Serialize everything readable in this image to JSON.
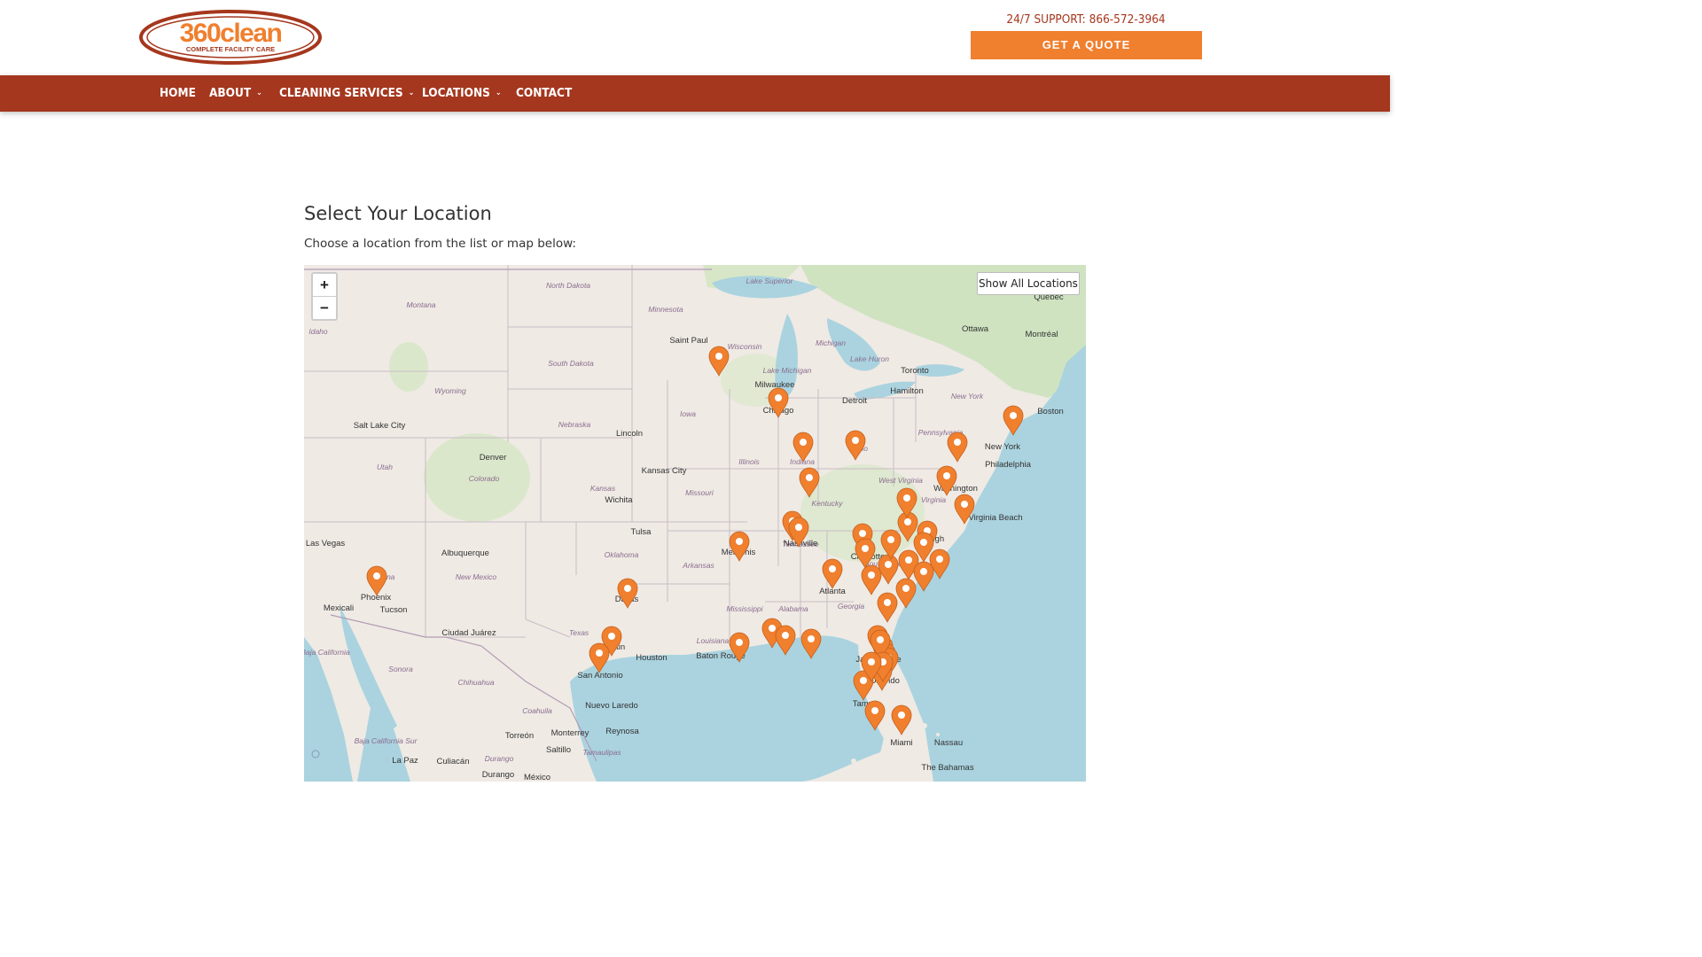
{
  "header": {
    "logo_text": "360clean",
    "logo_tagline": "COMPLETE FACILITY CARE",
    "support_text": "24/7 SUPPORT: 866-572-3964",
    "quote_button": "GET A QUOTE"
  },
  "nav": {
    "items": [
      {
        "label": "HOME"
      },
      {
        "label": "ABOUT"
      },
      {
        "label": "CLEANING SERVICES"
      },
      {
        "label": "LOCATIONS"
      },
      {
        "label": "CONTACT"
      }
    ]
  },
  "main": {
    "title": "Select Your Location",
    "subtitle": "Choose a location from the list or map below:"
  },
  "map": {
    "zoom_in": "+",
    "zoom_out": "−",
    "show_all_button": "Show All Locations",
    "place_labels": [
      "Saint Paul",
      "Milwaukee",
      "Chicago",
      "Detroit",
      "Toronto",
      "Hamilton",
      "Ottawa",
      "Montréal",
      "Québec",
      "Boston",
      "New York",
      "Philadelphia",
      "Washington",
      "Virginia Beach",
      "Denver",
      "Lincoln",
      "Kansas City",
      "Wichita",
      "Tulsa",
      "Salt Lake City",
      "Las Vegas",
      "Albuquerque",
      "Phoenix",
      "Tucson",
      "Mexicali",
      "Ciudad Juárez",
      "Dallas",
      "Austin",
      "San Antonio",
      "Houston",
      "Baton Rouge",
      "Memphis",
      "Atlanta",
      "Nashville",
      "Charlotte",
      "Raleigh",
      "Jacksonville",
      "Orlando",
      "Tampa",
      "Miami",
      "Nassau",
      "The Bahamas",
      "Nuevo Laredo",
      "Monterrey",
      "Reynosa",
      "Torreón",
      "Saltillo",
      "Culiacán",
      "La Paz",
      "Durango",
      "México"
    ],
    "region_labels": [
      "North Dakota",
      "Minnesota",
      "Montana",
      "Idaho",
      "South Dakota",
      "Wisconsin",
      "Wyoming",
      "Iowa",
      "Nebraska",
      "Utah",
      "Colorado",
      "Kansas",
      "Illinois",
      "Indiana",
      "Ohio",
      "Pennsylvania",
      "New York",
      "Michigan",
      "Missouri",
      "Kentucky",
      "West Virginia",
      "Virginia",
      "Tennessee",
      "Oklahoma",
      "New Mexico",
      "Arkansas",
      "Arizona",
      "Texas",
      "Louisiana",
      "Mississippi",
      "Alabama",
      "Georgia",
      "South Carolina",
      "Baja California",
      "Sonora",
      "Chihuahua",
      "Coahuila",
      "Baja California Sur",
      "Durango",
      "Tamaulipas",
      "Lake Superior",
      "Lake Michigan",
      "Lake Huron"
    ],
    "marker_color": "#f07f2e",
    "location_marker_count": 46
  },
  "colors": {
    "brand_red": "#a4371e",
    "accent_orange": "#f07f2e",
    "water": "#aad3df",
    "land": "#efeae4"
  }
}
